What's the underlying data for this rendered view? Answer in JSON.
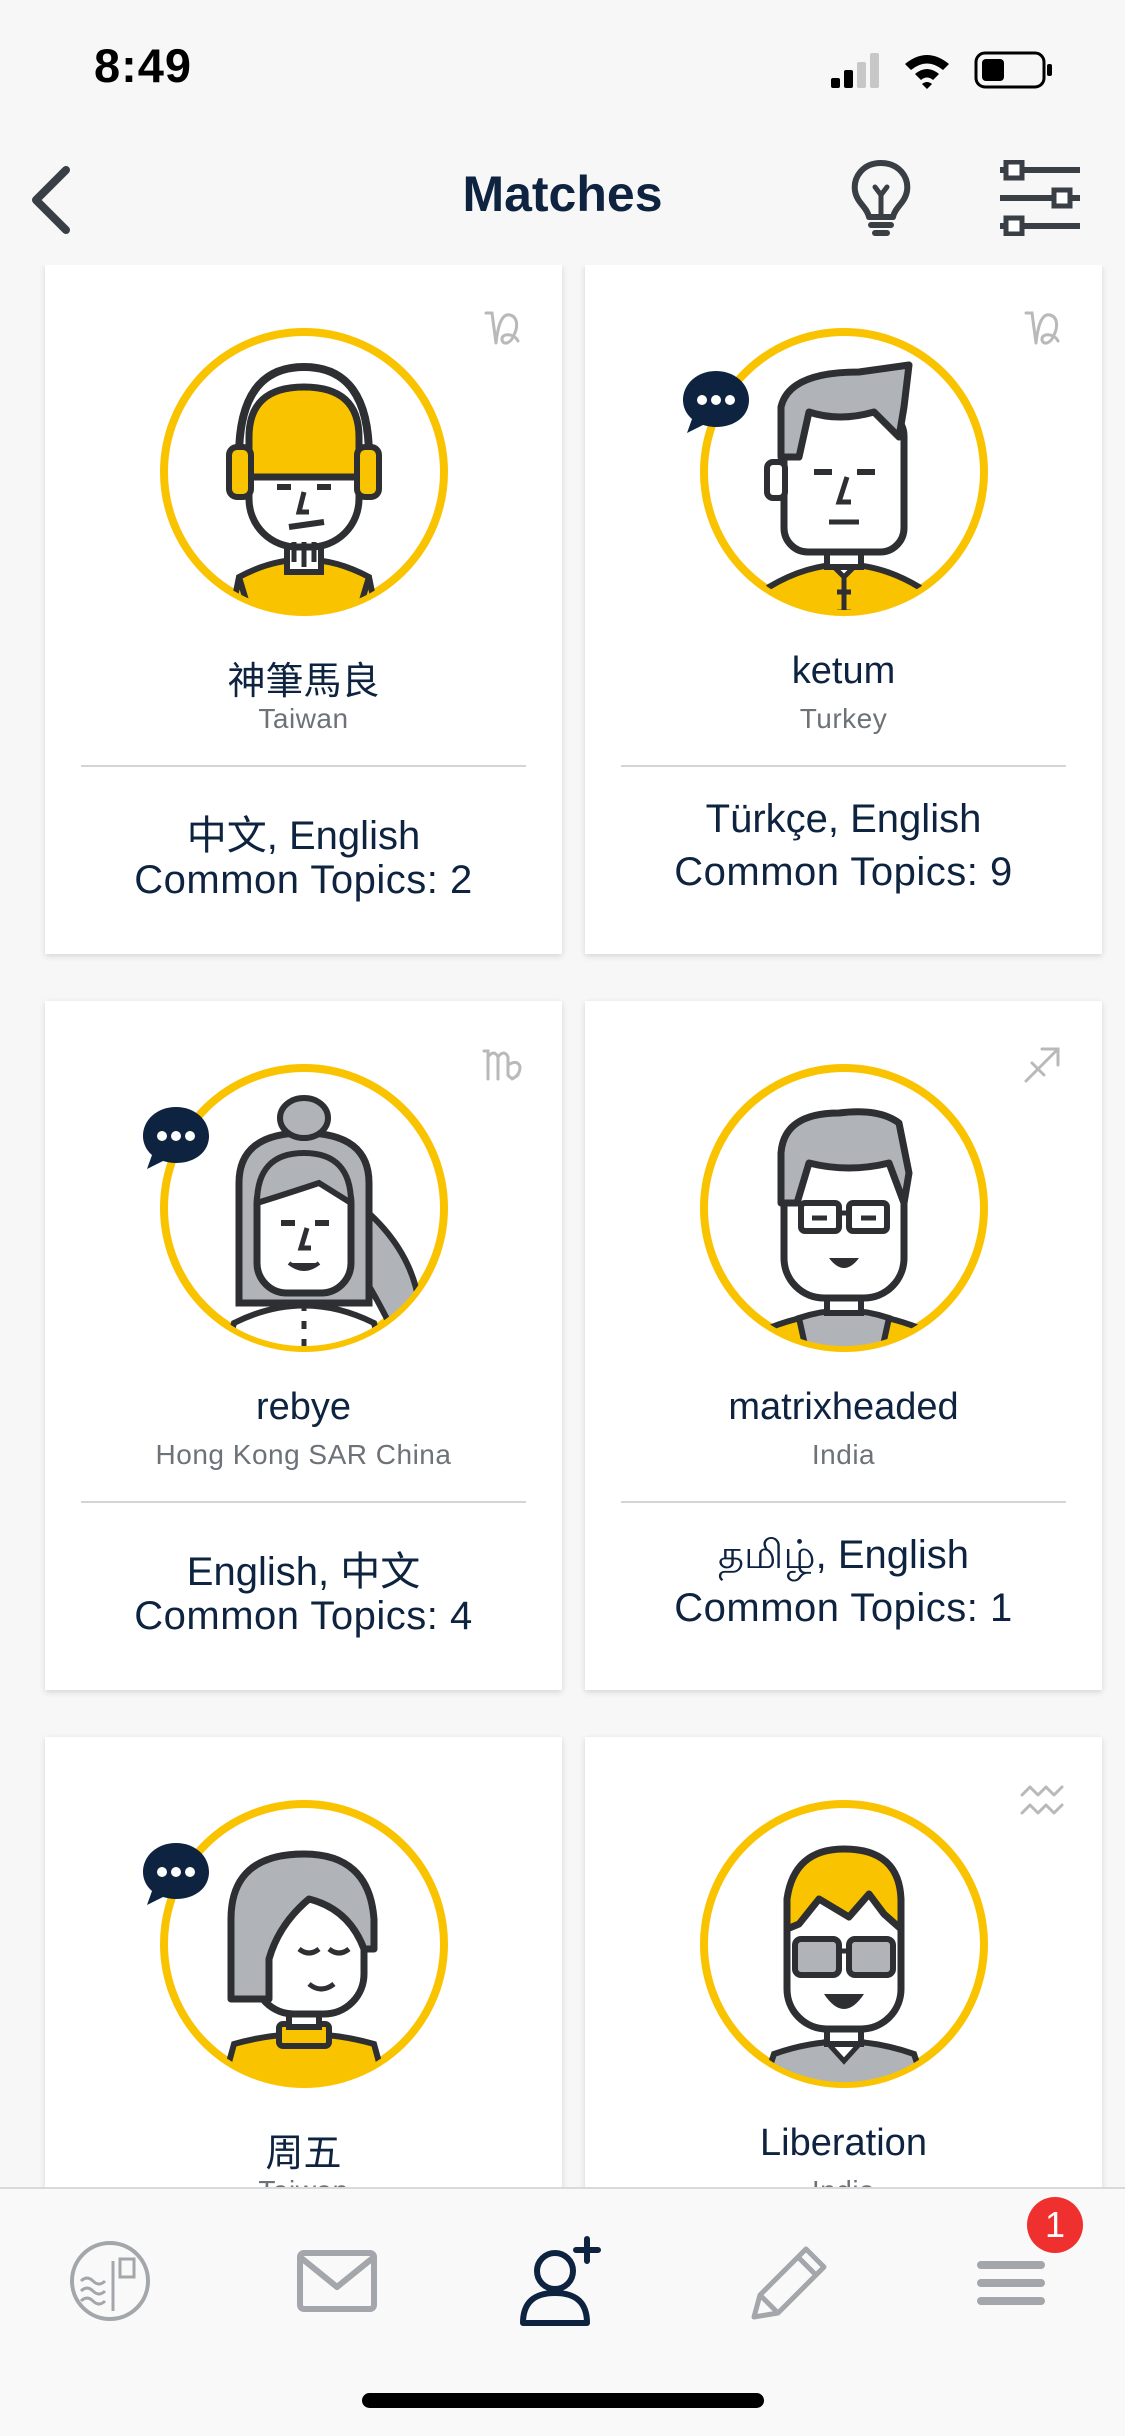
{
  "status_bar": {
    "time": "8:49"
  },
  "header": {
    "title": "Matches"
  },
  "matches": [
    {
      "name": "神筆馬良",
      "country": "Taiwan",
      "languages": "中文, English",
      "common_topics": "Common Topics: 2",
      "zodiac_icon": "capricorn-icon",
      "has_chat": false
    },
    {
      "name": "ketum",
      "country": "Turkey",
      "languages": "Türkçe, English",
      "common_topics": "Common Topics: 9",
      "zodiac_icon": "capricorn-icon",
      "has_chat": true
    },
    {
      "name": "rebye",
      "country": "Hong Kong SAR China",
      "languages": "English, 中文",
      "common_topics": "Common Topics: 4",
      "zodiac_icon": "virgo-icon",
      "has_chat": true
    },
    {
      "name": "matrixheaded",
      "country": "India",
      "languages": "தமிழ், English",
      "common_topics": "Common Topics: 1",
      "zodiac_icon": "sagittarius-icon",
      "has_chat": false
    },
    {
      "name": "周五",
      "country": "Taiwan",
      "languages": "",
      "common_topics": "",
      "zodiac_icon": "",
      "has_chat": true
    },
    {
      "name": "Liberation",
      "country": "India",
      "languages": "",
      "common_topics": "",
      "zodiac_icon": "aquarius-icon",
      "has_chat": false
    }
  ],
  "tab_bar": {
    "items": [
      "stamp-icon",
      "mail-icon",
      "add-friend-icon",
      "pencil-icon",
      "menu-icon"
    ],
    "active": "add-friend-icon",
    "menu_badge": "1"
  },
  "colors": {
    "accent_yellow": "#f9c300",
    "navy": "#0e2340",
    "badge_red": "#f0302e"
  }
}
